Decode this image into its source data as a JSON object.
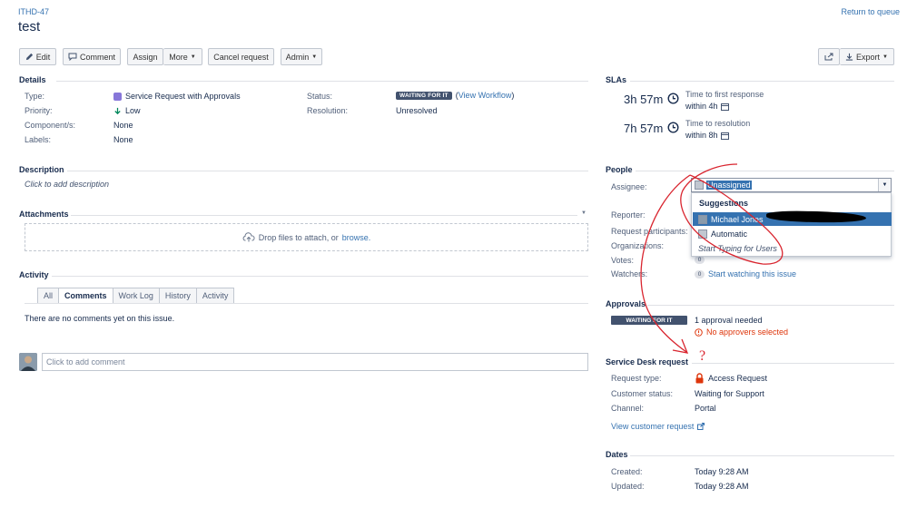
{
  "header": {
    "issue_key": "ITHD-47",
    "title": "test",
    "return_link": "Return to queue"
  },
  "toolbar": {
    "edit": "Edit",
    "comment": "Comment",
    "assign": "Assign",
    "more": "More",
    "cancel_request": "Cancel request",
    "admin": "Admin",
    "export": "Export"
  },
  "details": {
    "title": "Details",
    "type_label": "Type:",
    "type_value": "Service Request with Approvals",
    "priority_label": "Priority:",
    "priority_value": "Low",
    "components_label": "Component/s:",
    "components_value": "None",
    "labels_label": "Labels:",
    "labels_value": "None",
    "status_label": "Status:",
    "status_value": "WAITING FOR IT",
    "view_workflow": "View Workflow",
    "resolution_label": "Resolution:",
    "resolution_value": "Unresolved"
  },
  "description": {
    "title": "Description",
    "placeholder": "Click to add description"
  },
  "attachments": {
    "title": "Attachments",
    "drop_text": "Drop files to attach, or",
    "browse": "browse."
  },
  "activity": {
    "title": "Activity",
    "tabs": [
      "All",
      "Comments",
      "Work Log",
      "History",
      "Activity"
    ],
    "active_tab": "Comments",
    "empty_text": "There are no comments yet on this issue.",
    "comment_placeholder": "Click to add comment"
  },
  "slas": {
    "title": "SLAs",
    "items": [
      {
        "time": "3h 57m",
        "name": "Time to first response",
        "goal": "within 4h"
      },
      {
        "time": "7h 57m",
        "name": "Time to resolution",
        "goal": "within 8h"
      }
    ]
  },
  "people": {
    "title": "People",
    "assignee_label": "Assignee:",
    "assignee_value": "Unassigned",
    "reporter_label": "Reporter:",
    "participants_label": "Request participants:",
    "organizations_label": "Organizations:",
    "votes_label": "Votes:",
    "votes_count": "0",
    "watchers_label": "Watchers:",
    "watchers_count": "0",
    "watch_link": "Start watching this issue",
    "dropdown": {
      "heading": "Suggestions",
      "items": [
        {
          "label": "Michael Jones"
        },
        {
          "label": "Automatic"
        }
      ],
      "hint": "Start Typing for Users"
    }
  },
  "approvals": {
    "title": "Approvals",
    "status": "WAITING FOR IT",
    "needed": "1 approval needed",
    "error": "No approvers selected"
  },
  "service_desk": {
    "title": "Service Desk request",
    "request_type_label": "Request type:",
    "request_type_value": "Access Request",
    "customer_status_label": "Customer status:",
    "customer_status_value": "Waiting for Support",
    "channel_label": "Channel:",
    "channel_value": "Portal",
    "view_link": "View customer request"
  },
  "dates": {
    "title": "Dates",
    "created_label": "Created:",
    "created_value": "Today 9:28 AM",
    "updated_label": "Updated:",
    "updated_value": "Today 9:28 AM"
  },
  "annotation": {
    "question_mark": "?",
    "color": "#d9252f"
  }
}
